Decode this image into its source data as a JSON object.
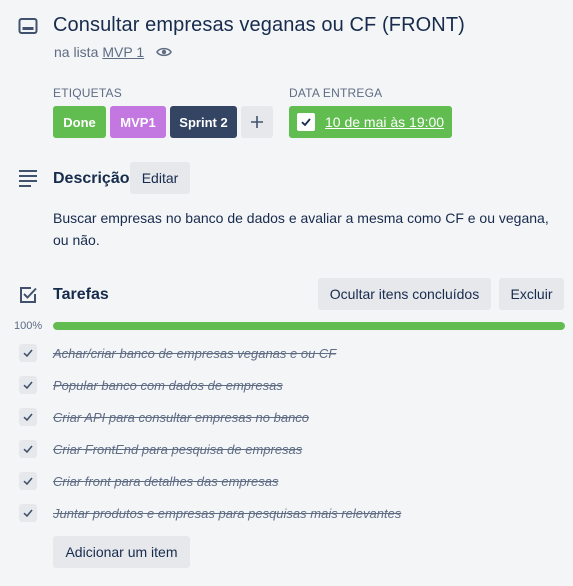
{
  "card": {
    "title": "Consultar empresas veganas ou CF (FRONT)",
    "list_prefix": "na lista",
    "list_name": "MVP 1"
  },
  "labels_section": {
    "heading": "ETIQUETAS",
    "labels": [
      {
        "text": "Done",
        "color": "#61bd4f"
      },
      {
        "text": "MVP1",
        "color": "#c377e0"
      },
      {
        "text": "Sprint 2",
        "color": "#344563"
      }
    ],
    "add_symbol": "+"
  },
  "due_section": {
    "heading": "DATA ENTREGA",
    "date_text": "10 de mai às 19:00",
    "complete": true,
    "color": "#61bd4f"
  },
  "description": {
    "title": "Descrição",
    "edit_label": "Editar",
    "body": "Buscar empresas no banco de dados e avaliar a mesma como CF e ou vegana, ou não."
  },
  "checklist": {
    "title": "Tarefas",
    "hide_label": "Ocultar itens concluídos",
    "delete_label": "Excluir",
    "progress_label": "100%",
    "progress": 1.0,
    "progress_color": "#61bd4f",
    "items": [
      {
        "text": "Achar/criar banco de empresas veganas e ou CF",
        "done": true
      },
      {
        "text": "Popular banco com dados de empresas",
        "done": true
      },
      {
        "text": "Criar API para consultar empresas no banco",
        "done": true
      },
      {
        "text": "Criar FrontEnd para pesquisa de empresas",
        "done": true
      },
      {
        "text": "Criar front para detalhes das empresas",
        "done": true
      },
      {
        "text": "Juntar produtos e empresas para pesquisas mais relevantes",
        "done": true
      }
    ],
    "add_item_label": "Adicionar um item"
  },
  "icons": [
    "card-icon",
    "eye-icon",
    "plus-icon",
    "checkbox-checked-icon",
    "description-icon",
    "checklist-icon",
    "checkmark-icon"
  ]
}
